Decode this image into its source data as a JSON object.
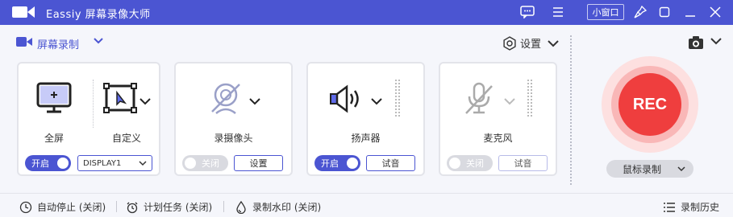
{
  "app": {
    "title": "Eassiy 屏幕录像大师",
    "accent": "#4b55d2",
    "rec_color": "#ef3e3e"
  },
  "titlebar": {
    "mini_window_label": "小窗口"
  },
  "mode": {
    "label": "屏幕录制"
  },
  "settings": {
    "label": "设置"
  },
  "screen_card": {
    "full_label": "全屏",
    "custom_label": "自定义",
    "toggle_label": "开启",
    "toggle_state": "on",
    "display_value": "DISPLAY1"
  },
  "camera_card": {
    "label": "录摄像头",
    "toggle_label": "关闭",
    "toggle_state": "off",
    "button_label": "设置"
  },
  "speaker_card": {
    "label": "扬声器",
    "toggle_label": "开启",
    "toggle_state": "on",
    "button_label": "试音"
  },
  "mic_card": {
    "label": "麦克风",
    "toggle_label": "关闭",
    "toggle_state": "off",
    "button_label": "试音"
  },
  "rec": {
    "label": "REC",
    "mouse_label": "鼠标录制"
  },
  "footer": {
    "auto_stop": "自动停止 (关闭)",
    "schedule": "计划任务 (关闭)",
    "watermark": "录制水印 (关闭)",
    "history": "录制历史"
  }
}
